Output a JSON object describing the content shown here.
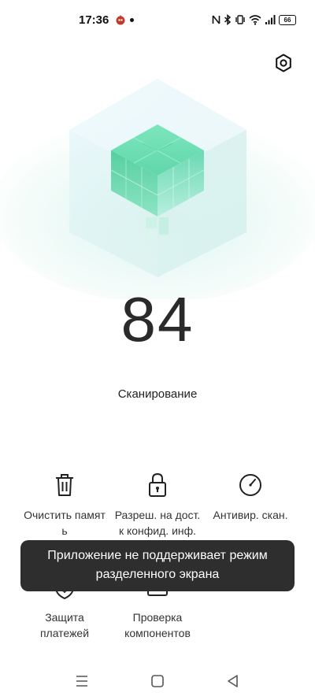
{
  "status_bar": {
    "time": "17:36",
    "battery": "66",
    "icons": [
      "app-notification-icon",
      "nfc-icon",
      "bluetooth-icon",
      "vibrate-icon",
      "wifi-icon",
      "signal-icon",
      "battery-icon"
    ]
  },
  "header": {
    "settings_icon": "settings-icon"
  },
  "score": {
    "value": "84",
    "label": "Сканирование"
  },
  "features": [
    {
      "icon": "trash-icon",
      "line1": "Очистить памят",
      "line2": "ь"
    },
    {
      "icon": "lock-icon",
      "line1": "Разреш. на дост.",
      "line2": "к конфид. инф."
    },
    {
      "icon": "gauge-icon",
      "line1": "Антивир. скан.",
      "line2": ""
    },
    {
      "icon": "shield-dollar-icon",
      "line1": "Защита",
      "line2": "платежей"
    },
    {
      "icon": "component-check-icon",
      "line1": "Проверка",
      "line2": "компонентов"
    }
  ],
  "toast": {
    "line1": "Приложение не поддерживает режим",
    "line2": "разделенного экрана"
  },
  "nav": {
    "icons": [
      "menu-icon",
      "home-icon",
      "back-icon"
    ]
  },
  "colors": {
    "accent": "#4fd1a5",
    "toast_bg": "#2e2e2e"
  }
}
